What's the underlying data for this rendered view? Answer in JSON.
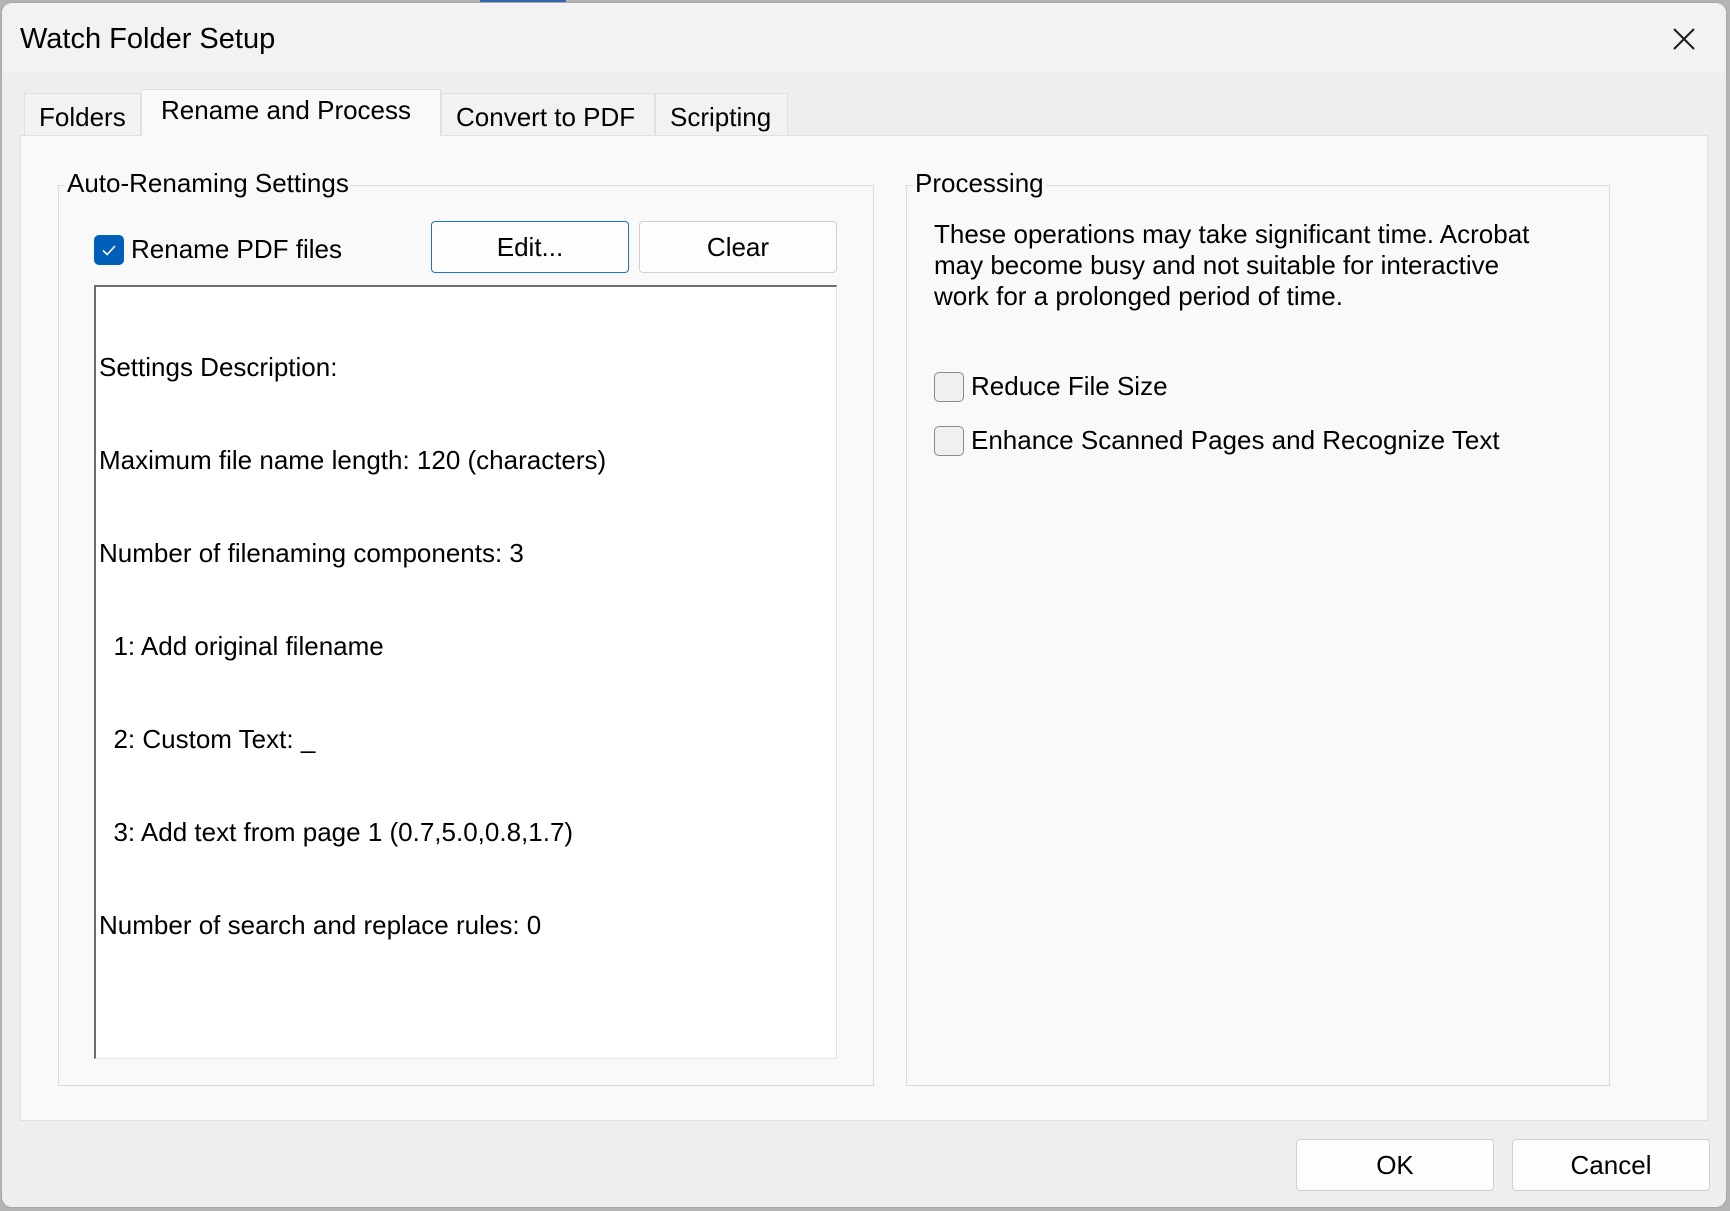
{
  "window": {
    "title": "Watch Folder Setup",
    "close_icon": "close-icon"
  },
  "tabs": [
    {
      "label": "Folders",
      "active": false
    },
    {
      "label": "Rename and Process",
      "active": true
    },
    {
      "label": "Convert to PDF",
      "active": false
    },
    {
      "label": "Scripting",
      "active": false
    }
  ],
  "auto_renaming": {
    "group_label": "Auto-Renaming Settings",
    "rename_checkbox": {
      "label": "Rename PDF files",
      "checked": true
    },
    "edit_button": "Edit...",
    "clear_button": "Clear",
    "description_lines": [
      "Settings Description:",
      "Maximum file name length: 120 (characters)",
      "Number of filenaming components: 3",
      "  1: Add original filename",
      "  2: Custom Text: _",
      "  3: Add text from page 1 (0.7,5.0,0.8,1.7)",
      "Number of search and replace rules: 0"
    ]
  },
  "processing": {
    "group_label": "Processing",
    "info_lines": [
      "These operations may take significant time. Acrobat",
      "may become busy and not suitable for interactive",
      "work for a prolonged period of time."
    ],
    "options": [
      {
        "label": "Reduce File Size",
        "checked": false
      },
      {
        "label": "Enhance Scanned Pages and Recognize Text",
        "checked": false
      }
    ]
  },
  "footer": {
    "ok_button": "OK",
    "cancel_button": "Cancel"
  },
  "colors": {
    "accent": "#005fb8",
    "focus_border": "#1a73c4"
  }
}
